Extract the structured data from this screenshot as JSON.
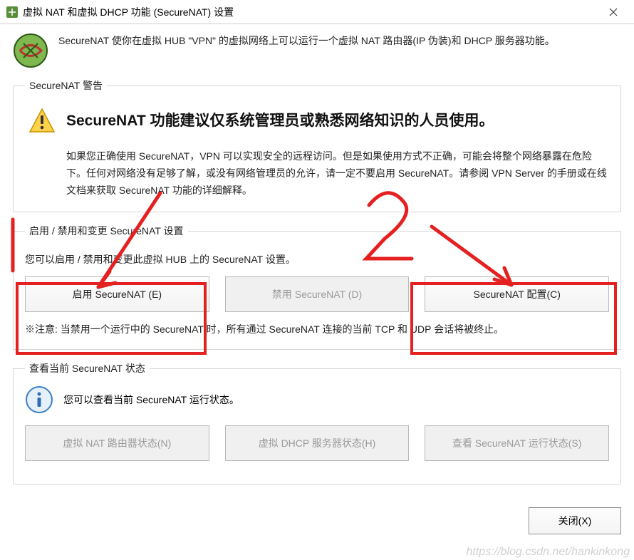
{
  "window": {
    "title": "虚拟 NAT 和虚拟 DHCP 功能 (SecureNAT) 设置"
  },
  "intro": {
    "text": "SecureNAT 使你在虚拟 HUB \"VPN\" 的虚拟网络上可以运行一个虚拟 NAT 路由器(IP 伪装)和 DHCP 服务器功能。"
  },
  "warning": {
    "legend": "SecureNAT 警告",
    "title": "SecureNAT 功能建议仅系统管理员或熟悉网络知识的人员使用。",
    "body": "如果您正确使用 SecureNAT，VPN 可以实现安全的远程访问。但是如果使用方式不正确，可能会将整个网络暴露在危险下。任何对网络没有足够了解，或没有网络管理员的允许，请一定不要启用 SecureNAT。请参阅 VPN Server 的手册或在线文档来获取 SecureNAT 功能的详细解释。"
  },
  "config": {
    "legend": "启用 / 禁用和变更 SecureNAT 设置",
    "desc": "您可以启用 / 禁用和变更此虚拟 HUB 上的 SecureNAT 设置。",
    "enable_btn": "启用 SecureNAT (E)",
    "disable_btn": "禁用 SecureNAT (D)",
    "configure_btn": "SecureNAT 配置(C)",
    "note": "※注意: 当禁用一个运行中的 SecureNAT 时，所有通过 SecureNAT 连接的当前 TCP 和 UDP 会话将被终止。"
  },
  "status": {
    "legend": "查看当前 SecureNAT 状态",
    "desc": "您可以查看当前 SecureNAT 运行状态。",
    "nat_btn": "虚拟 NAT 路由器状态(N)",
    "dhcp_btn": "虚拟 DHCP 服务器状态(H)",
    "runtime_btn": "查看 SecureNAT 运行状态(S)"
  },
  "footer": {
    "close_btn": "关闭(X)"
  },
  "watermark": "https://blog.csdn.net/hankinkong",
  "annotations": {
    "one": "1",
    "two": "2"
  }
}
